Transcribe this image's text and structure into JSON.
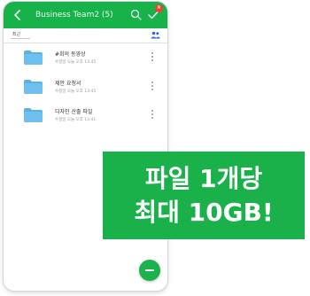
{
  "header": {
    "title": "Business Team2 (5)",
    "badge": "N",
    "color": "#18b24a"
  },
  "toolbar": {
    "sort_label": "최근"
  },
  "files": [
    {
      "name": "#회의 동영상",
      "meta": "수정일 오늘 오후 13:45",
      "icon": "folder-icon"
    },
    {
      "name": "제안 요청서",
      "meta": "수정일 오늘 오후 13:45",
      "icon": "folder-icon"
    },
    {
      "name": "디자인 산출 파일",
      "meta": "수정일 오늘 오후 13:41",
      "icon": "folder-icon"
    }
  ],
  "promo": {
    "line1": "파일 1개당",
    "line2": "최대 10GB!",
    "color": "#1ab14a"
  },
  "icons": {
    "back": "chevron-left-icon",
    "search": "search-icon",
    "check": "check-icon",
    "members": "members-icon",
    "more": "kebab-icon",
    "fab": "minus-icon"
  }
}
